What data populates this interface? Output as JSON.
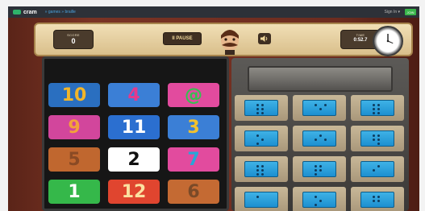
{
  "site": {
    "brand": "cram",
    "breadcrumb": "» games » braille",
    "signin": "Sign In ▾",
    "join": "JOIN"
  },
  "hud": {
    "score_label": "SCORE",
    "score": "0",
    "pause_label": "II PAUSE",
    "time_label": "TIME",
    "time_value": "0:52.7"
  },
  "colors": {
    "frame": "#6d2c1f",
    "hud": "#e6d1a2",
    "accent_blue": "#1c8fd0"
  },
  "tiles": [
    {
      "label": "10",
      "bg": "#2a6fc0",
      "fg": "#f1b52a"
    },
    {
      "label": "4",
      "bg": "#3b7fd6",
      "fg": "#e33a8c"
    },
    {
      "label": "@",
      "bg": "#e24b9e",
      "fg": "#35c150"
    },
    {
      "label": "9",
      "bg": "#d2469c",
      "fg": "#f3a23a"
    },
    {
      "label": "11",
      "bg": "#2b6fd0",
      "fg": "#ffffff"
    },
    {
      "label": "3",
      "bg": "#3b7fd6",
      "fg": "#f2c12e"
    },
    {
      "label": "5",
      "bg": "#c0672f",
      "fg": "#8a4a24"
    },
    {
      "label": "2",
      "bg": "#ffffff",
      "fg": "#111111"
    },
    {
      "label": "7",
      "bg": "#e24b9e",
      "fg": "#27a6d8"
    },
    {
      "label": "1",
      "bg": "#35b84a",
      "fg": "#ffffff"
    },
    {
      "label": "12",
      "bg": "#e0452f",
      "fg": "#fbe0a0"
    },
    {
      "label": "6",
      "bg": "#c46a33",
      "fg": "#7a4a28"
    }
  ],
  "braille_cards": [
    [
      [
        0,
        0
      ],
      [
        0,
        1
      ],
      [
        1,
        0
      ],
      [
        1,
        1
      ],
      [
        2,
        0
      ],
      [
        2,
        1
      ]
    ],
    [
      [
        0,
        0
      ],
      [
        0,
        2
      ],
      [
        1,
        1
      ]
    ],
    [
      [
        0,
        0
      ],
      [
        0,
        1
      ],
      [
        1,
        0
      ],
      [
        1,
        1
      ],
      [
        2,
        0
      ],
      [
        2,
        1
      ]
    ],
    [
      [
        0,
        0
      ],
      [
        1,
        1
      ],
      [
        2,
        0
      ]
    ],
    [
      [
        0,
        1
      ],
      [
        1,
        0
      ],
      [
        1,
        2
      ]
    ],
    [
      [
        0,
        0
      ],
      [
        0,
        1
      ],
      [
        1,
        0
      ],
      [
        1,
        1
      ],
      [
        2,
        1
      ]
    ],
    [
      [
        0,
        0
      ],
      [
        0,
        1
      ],
      [
        1,
        0
      ],
      [
        1,
        1
      ],
      [
        2,
        0
      ],
      [
        2,
        1
      ]
    ],
    [
      [
        0,
        0
      ],
      [
        0,
        1
      ],
      [
        1,
        0
      ],
      [
        1,
        1
      ],
      [
        2,
        0
      ]
    ],
    [
      [
        0,
        1
      ],
      [
        1,
        0
      ]
    ],
    [
      [
        0,
        0
      ]
    ],
    [
      [
        0,
        0
      ],
      [
        1,
        1
      ],
      [
        2,
        0
      ]
    ],
    [
      [
        0,
        0
      ],
      [
        0,
        1
      ],
      [
        1,
        0
      ],
      [
        1,
        1
      ]
    ]
  ]
}
